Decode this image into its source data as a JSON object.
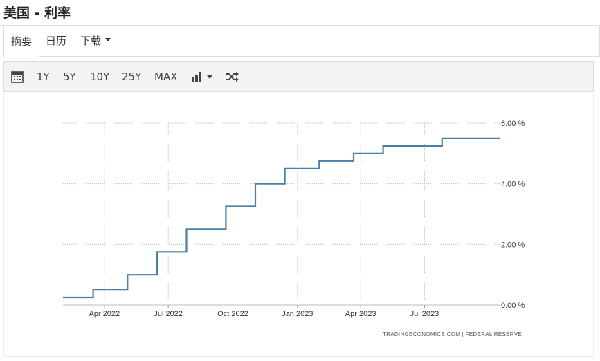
{
  "page": {
    "title": "美国 - 利率"
  },
  "tabs": [
    {
      "label": "摘要"
    },
    {
      "label": "日历"
    },
    {
      "label": "下载"
    }
  ],
  "toolbar": {
    "calendar_icon": "calendar-icon",
    "ranges": [
      {
        "label": "1Y"
      },
      {
        "label": "5Y"
      },
      {
        "label": "10Y"
      },
      {
        "label": "25Y"
      },
      {
        "label": "MAX"
      }
    ],
    "chart_type_icon": "bar-chart-icon",
    "shuffle_icon": "shuffle-icon"
  },
  "chart_data": {
    "type": "line",
    "title": "",
    "xlabel": "",
    "ylabel": "",
    "line_color": "#4a7fa8",
    "step": true,
    "grid": true,
    "xlim": [
      "2022-02-01",
      "2023-10-16"
    ],
    "ylim": [
      0,
      6
    ],
    "y_ticks": [
      {
        "value": 0,
        "label": "0.00 %"
      },
      {
        "value": 2,
        "label": "2.00 %"
      },
      {
        "value": 4,
        "label": "4.00 %"
      },
      {
        "value": 6,
        "label": "6.00 %"
      }
    ],
    "x_ticks": [
      {
        "date": "2022-04-01",
        "label": "Apr 2022"
      },
      {
        "date": "2022-07-01",
        "label": "Jul 2022"
      },
      {
        "date": "2022-10-01",
        "label": "Oct 2022"
      },
      {
        "date": "2023-01-01",
        "label": "Jan 2023"
      },
      {
        "date": "2023-04-01",
        "label": "Apr 2023"
      },
      {
        "date": "2023-07-01",
        "label": "Jul 2023"
      }
    ],
    "series": [
      {
        "points": [
          {
            "x": "2022-02-01",
            "y": 0.25
          },
          {
            "x": "2022-03-16",
            "y": 0.5
          },
          {
            "x": "2022-05-04",
            "y": 1.0
          },
          {
            "x": "2022-06-15",
            "y": 1.75
          },
          {
            "x": "2022-07-27",
            "y": 2.5
          },
          {
            "x": "2022-09-21",
            "y": 3.25
          },
          {
            "x": "2022-11-02",
            "y": 4.0
          },
          {
            "x": "2022-12-14",
            "y": 4.5
          },
          {
            "x": "2023-02-01",
            "y": 4.75
          },
          {
            "x": "2023-03-22",
            "y": 5.0
          },
          {
            "x": "2023-05-03",
            "y": 5.25
          },
          {
            "x": "2023-07-26",
            "y": 5.5
          },
          {
            "x": "2023-10-16",
            "y": 5.5
          }
        ]
      }
    ],
    "source": "TRADINGECONOMICS.COM  |  FEDERAL  RESERVE"
  }
}
